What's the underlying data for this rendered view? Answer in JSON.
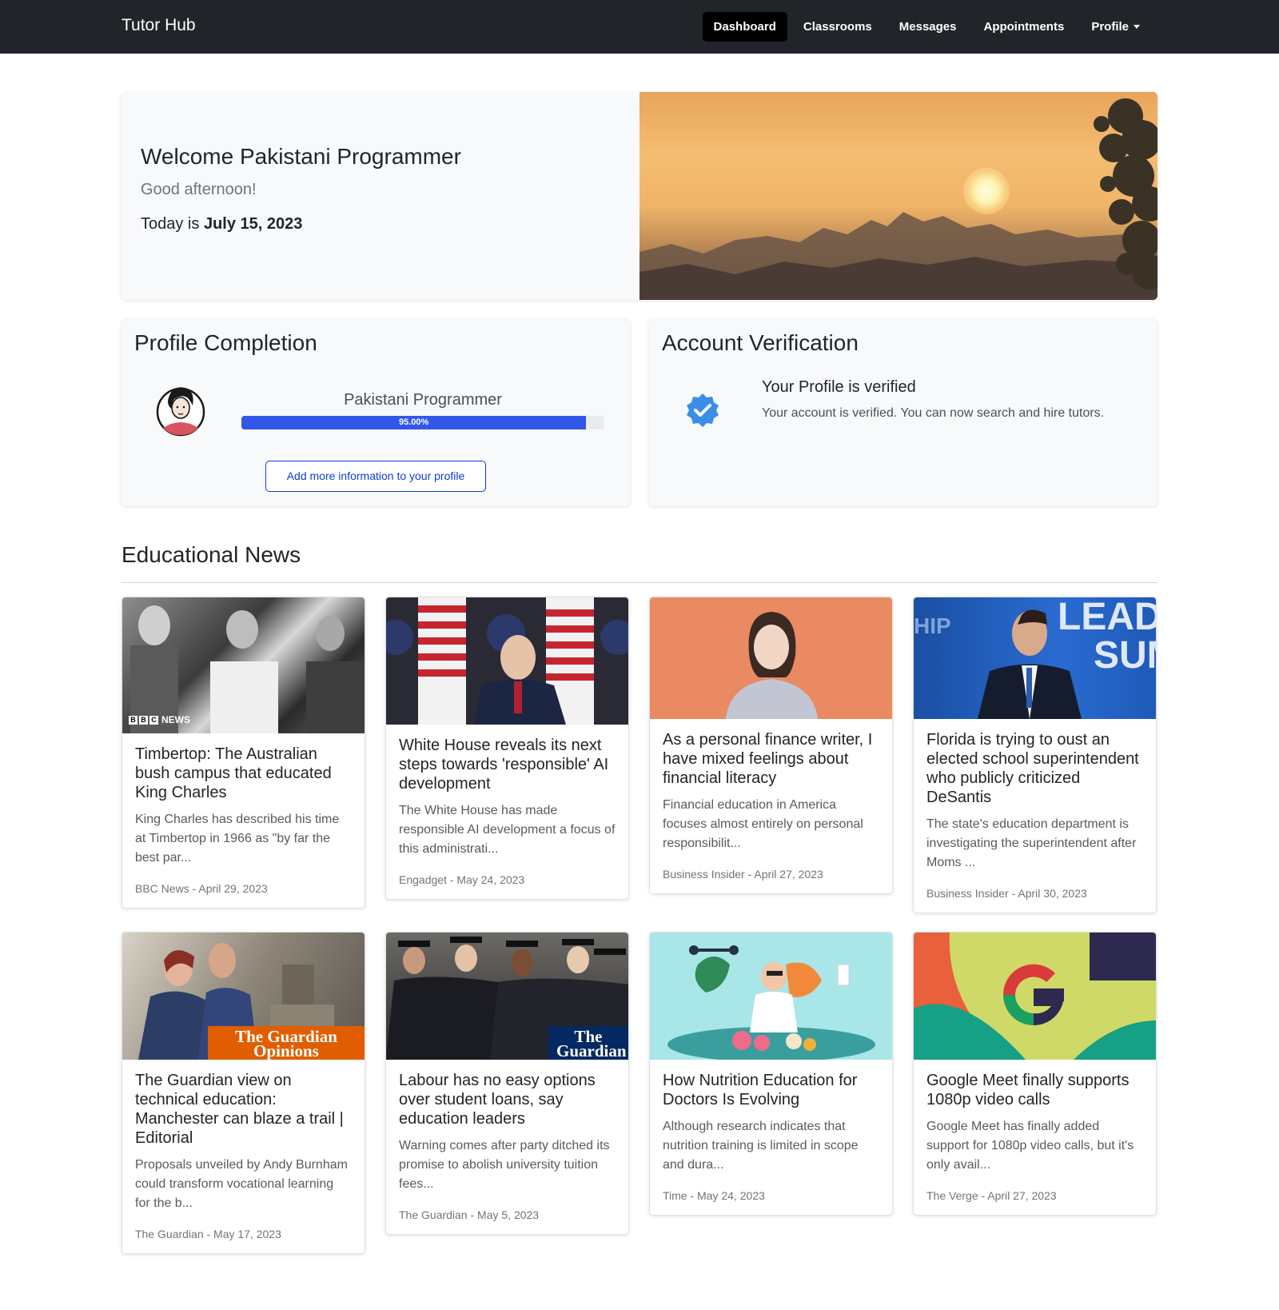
{
  "nav": {
    "brand": "Tutor Hub",
    "items": [
      "Dashboard",
      "Classrooms",
      "Messages",
      "Appointments",
      "Profile"
    ]
  },
  "hero": {
    "title": "Welcome Pakistani Programmer",
    "greeting": "Good afternoon!",
    "date_prefix": "Today is ",
    "date": "July 15, 2023"
  },
  "profile_completion": {
    "title": "Profile Completion",
    "name": "Pakistani Programmer",
    "progress_label": "95.00%",
    "progress_value": 0.95,
    "button": "Add more information to your profile"
  },
  "verification": {
    "title": "Account Verification",
    "status": "Your Profile is verified",
    "text": "Your account is verified. You can now search and hire tutors."
  },
  "news": {
    "heading": "Educational News",
    "articles": [
      {
        "title": "Timbertop: The Australian bush campus that educated King Charles",
        "desc": "King Charles has described his time at Timbertop in 1966 as \"by far the best par...",
        "meta": "BBC News - April 29, 2023",
        "logo": "NEWS"
      },
      {
        "title": "White House reveals its next steps towards 'responsible' AI development",
        "desc": "The White House has made responsible AI development a focus of this administrati...",
        "meta": "Engadget - May 24, 2023"
      },
      {
        "title": "As a personal finance writer, I have mixed feelings about financial literacy",
        "desc": "Financial education in America focuses almost entirely on personal responsibilit...",
        "meta": "Business Insider - April 27, 2023"
      },
      {
        "title": "Florida is trying to oust an elected school superintendent who publicly criticized DeSantis",
        "desc": "The state's education department is investigating the superintendent after Moms ...",
        "meta": "Business Insider - April 30, 2023"
      },
      {
        "title": "The Guardian view on technical education: Manchester can blaze a trail | Editorial",
        "desc": "Proposals unveiled by Andy Burnham could transform vocational learning for the b...",
        "meta": "The Guardian - May 17, 2023",
        "logo": "The Guardian Opinions"
      },
      {
        "title": "Labour has no easy options over student loans, say education leaders",
        "desc": "Warning comes after party ditched its promise to abolish university tuition fees...",
        "meta": "The Guardian - May 5, 2023",
        "logo": "The Guardian"
      },
      {
        "title": "How Nutrition Education for Doctors Is Evolving",
        "desc": "Although research indicates that nutrition training is limited in scope and dura...",
        "meta": "Time - May 24, 2023"
      },
      {
        "title": "Google Meet finally supports 1080p video calls",
        "desc": "Google Meet has finally added support for 1080p video calls, but it's only avail...",
        "meta": "The Verge - April 27, 2023"
      }
    ]
  },
  "colors": {
    "navbar": "#212529",
    "accent": "#3156e8",
    "verified": "#3a8ee6"
  },
  "icons": [
    "verified-badge-icon",
    "chevron-down-icon"
  ]
}
